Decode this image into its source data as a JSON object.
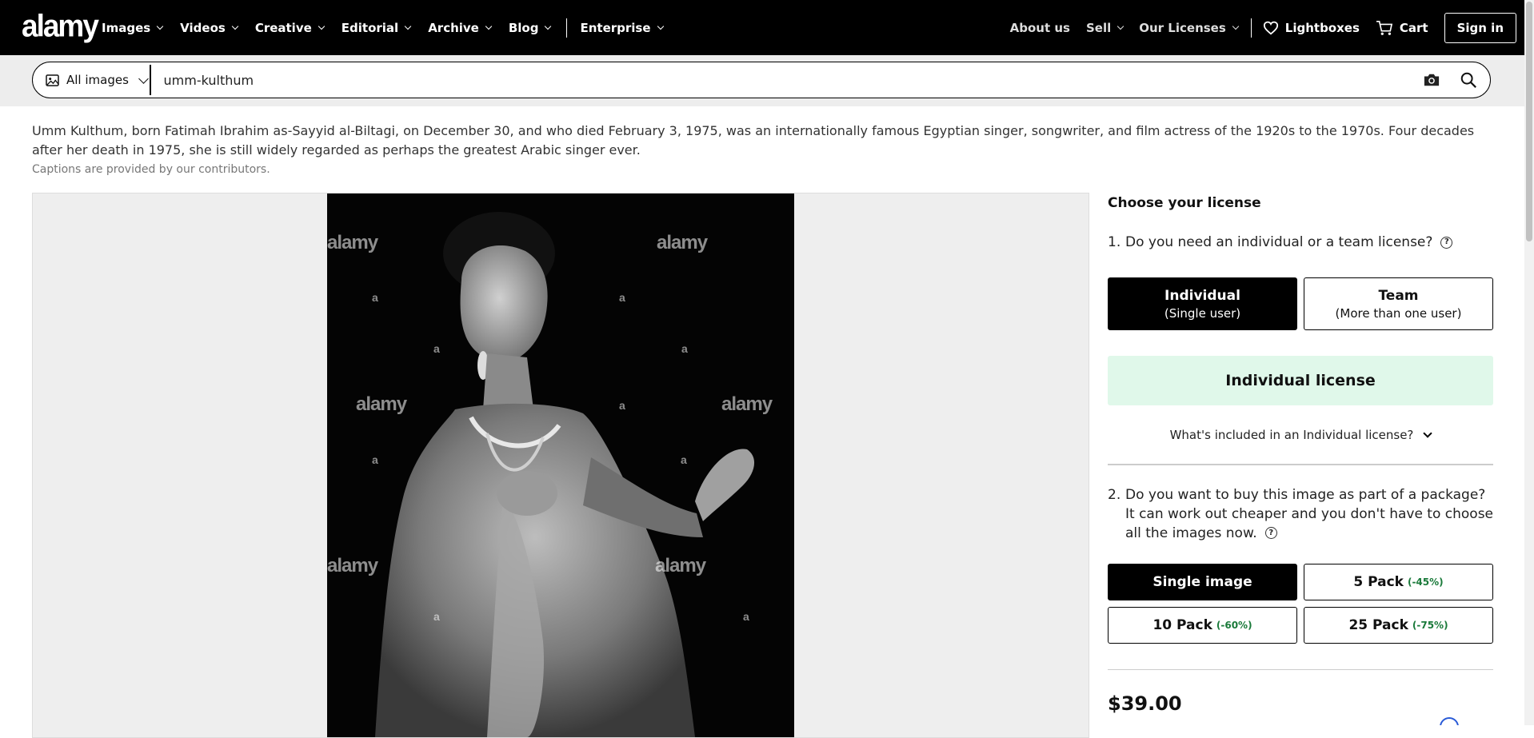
{
  "brand": {
    "logo_text": "alamy"
  },
  "nav": {
    "left_items": [
      {
        "label": "Images"
      },
      {
        "label": "Videos"
      },
      {
        "label": "Creative"
      },
      {
        "label": "Editorial"
      },
      {
        "label": "Archive"
      },
      {
        "label": "Blog"
      }
    ],
    "enterprise": "Enterprise",
    "right": {
      "about": "About us",
      "sell": "Sell",
      "licenses": "Our Licenses",
      "lightboxes": "Lightboxes",
      "cart": "Cart",
      "signin": "Sign in"
    }
  },
  "search": {
    "scope": "All images",
    "value": "umm-kulthum",
    "icons": [
      "camera-icon",
      "search-icon"
    ]
  },
  "caption": {
    "text": "Umm Kulthum, born Fatimah Ibrahim as-Sayyid al-Biltagi, on December 30, and who died February 3, 1975, was an internationally famous Egyptian singer, songwriter, and film actress of the 1920s to the 1970s. Four decades after her death in 1975, she is still widely regarded as perhaps the greatest Arabic singer ever.",
    "note": "Captions are provided by our contributors."
  },
  "image": {
    "watermark": "alamy",
    "watermark_small": "a"
  },
  "license": {
    "title": "Choose your license",
    "q1_num": "1.",
    "q1": "Do you need an individual or a team license?",
    "individual": {
      "title": "Individual",
      "sub": "(Single user)"
    },
    "team": {
      "title": "Team",
      "sub": "(More than one user)"
    },
    "selected_license": "Individual license",
    "included_link": "What's included in an Individual license?",
    "q2_num": "2.",
    "q2": "Do you want to buy this image as part of a package? It can work out cheaper and you don't have to choose all the images now.",
    "packages": [
      {
        "label": "Single image",
        "discount": ""
      },
      {
        "label": "5 Pack",
        "discount": "(-45%)"
      },
      {
        "label": "10 Pack",
        "discount": "(-60%)"
      },
      {
        "label": "25 Pack",
        "discount": "(-75%)"
      }
    ],
    "price": "$39.00"
  },
  "colors": {
    "nav_bg": "#000000",
    "license_highlight": "#e0f8ea",
    "discount_green": "#1a7a3a"
  }
}
